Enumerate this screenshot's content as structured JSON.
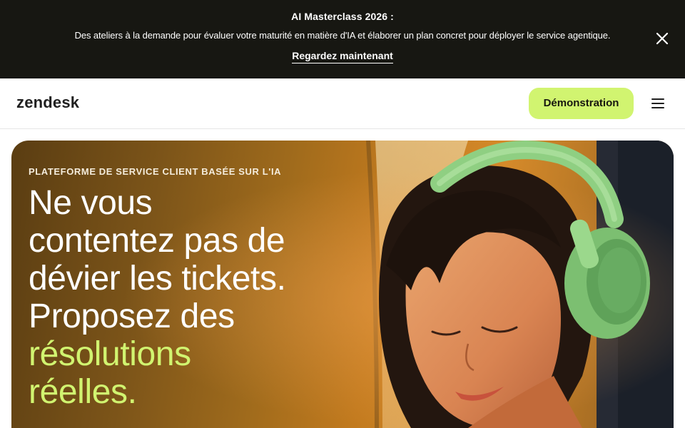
{
  "banner": {
    "title": "AI Masterclass 2026 :",
    "description": "Des ateliers à la demande pour évaluer votre maturité en matière d'IA et élaborer un plan concret pour déployer le service agentique.",
    "link_label": "Regardez maintenant",
    "close_icon": "close-icon"
  },
  "header": {
    "logo_text": "zendesk",
    "demo_label": "Démonstration",
    "menu_icon": "hamburger-menu-icon"
  },
  "hero": {
    "eyebrow": "PLATEFORME DE SERVICE CLIENT BASÉE SUR L'IA",
    "headline_lines": [
      "Ne vous",
      "contentez pas de",
      "dévier les tickets.",
      "Proposez des"
    ],
    "headline_accent_lines": [
      "résolutions",
      "réelles."
    ]
  },
  "colors": {
    "banner_bg": "#171712",
    "accent_lime": "#d1f470",
    "text_dark": "#1f1f1f",
    "hero_warm": "#c27a1e"
  }
}
